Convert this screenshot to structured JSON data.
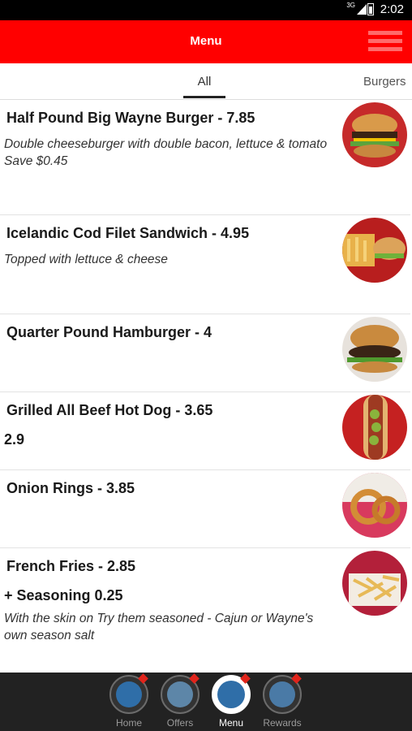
{
  "status_bar": {
    "network": "3G",
    "time": "2:02"
  },
  "app_bar": {
    "title": "Menu",
    "menu_icon": "hamburger-icon"
  },
  "tabs": {
    "all": "All",
    "burgers": "Burgers",
    "selected": "All"
  },
  "items": [
    {
      "name": "Half Pound Big Wayne Burger - 7.85",
      "desc": "Double cheeseburger with double bacon, lettuce & tomato Save $0.45",
      "image": "burger-photo"
    },
    {
      "name": "Icelandic Cod Filet Sandwich - 4.95",
      "desc": "Topped with lettuce & cheese",
      "image": "fish-sandwich-photo"
    },
    {
      "name": "Quarter Pound Hamburger - 4",
      "image": "hamburger-photo"
    },
    {
      "name": "Grilled All Beef Hot Dog - 3.65",
      "extra": "2.9",
      "image": "hot-dog-photo"
    },
    {
      "name": "Onion Rings - 3.85",
      "image": "onion-rings-photo"
    },
    {
      "name": "French Fries - 2.85",
      "extra": "+ Seasoning 0.25",
      "desc": "With the skin on Try them seasoned - Cajun or Wayne's own season salt",
      "image": "fries-photo"
    }
  ],
  "bottom_nav": [
    {
      "label": "Home",
      "icon": "globe-icon"
    },
    {
      "label": "Offers",
      "icon": "thumbs-up-icon"
    },
    {
      "label": "Menu",
      "icon": "burger-icon",
      "active": true
    },
    {
      "label": "Rewards",
      "icon": "handshake-icon"
    }
  ],
  "colors": {
    "app_bar": "#ff0000",
    "status_bar": "#000000",
    "bottom_nav": "#222222"
  }
}
